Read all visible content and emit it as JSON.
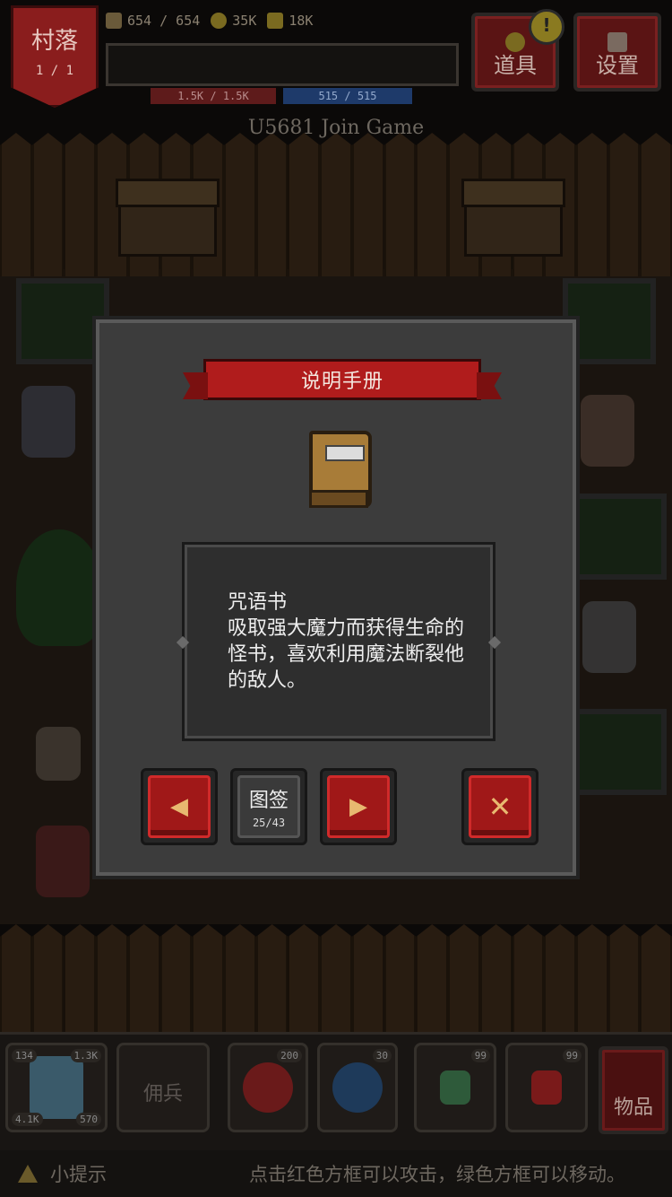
{
  "hud": {
    "location_title": "村落",
    "location_sub": "1 / 1",
    "stats": [
      {
        "icon": "person-icon",
        "value": "654 / 654"
      },
      {
        "icon": "coin-icon",
        "value": "35K"
      },
      {
        "icon": "crown-icon",
        "value": "18K"
      }
    ],
    "hp_text": "1.5K / 1.5K",
    "mp_text": "515 / 515",
    "join_text": "U5681 Join Game",
    "tools_label": "道具",
    "settings_label": "设置",
    "alert_glyph": "!"
  },
  "modal": {
    "title": "说明手册",
    "entry_name": "咒语书",
    "entry_desc": "吸取强大魔力而获得生命的怪书，喜欢利用魔法断裂他的敌人。",
    "prev_glyph": "◀",
    "next_glyph": "▶",
    "close_glyph": "✕",
    "gallery_label": "图签",
    "gallery_count": "25/43"
  },
  "bottom": {
    "hero_badges": [
      "134",
      "1.3K",
      "4.1K",
      "570"
    ],
    "mercenary_label": "佣兵",
    "skill1_badge": "200",
    "skill2_badge": "30",
    "potion_green_badge": "99",
    "potion_red_badge": "99",
    "items_label": "物品",
    "tip_label": "小提示",
    "tip_text": "点击红色方框可以攻击，绿色方框可以移动。"
  },
  "colors": {
    "accent_red": "#b01c1c",
    "panel_gray": "#3c3c3c",
    "button_icon_gold": "#e8b870",
    "hp_red": "#5e1b1b",
    "mp_blue": "#1e3a6a"
  }
}
